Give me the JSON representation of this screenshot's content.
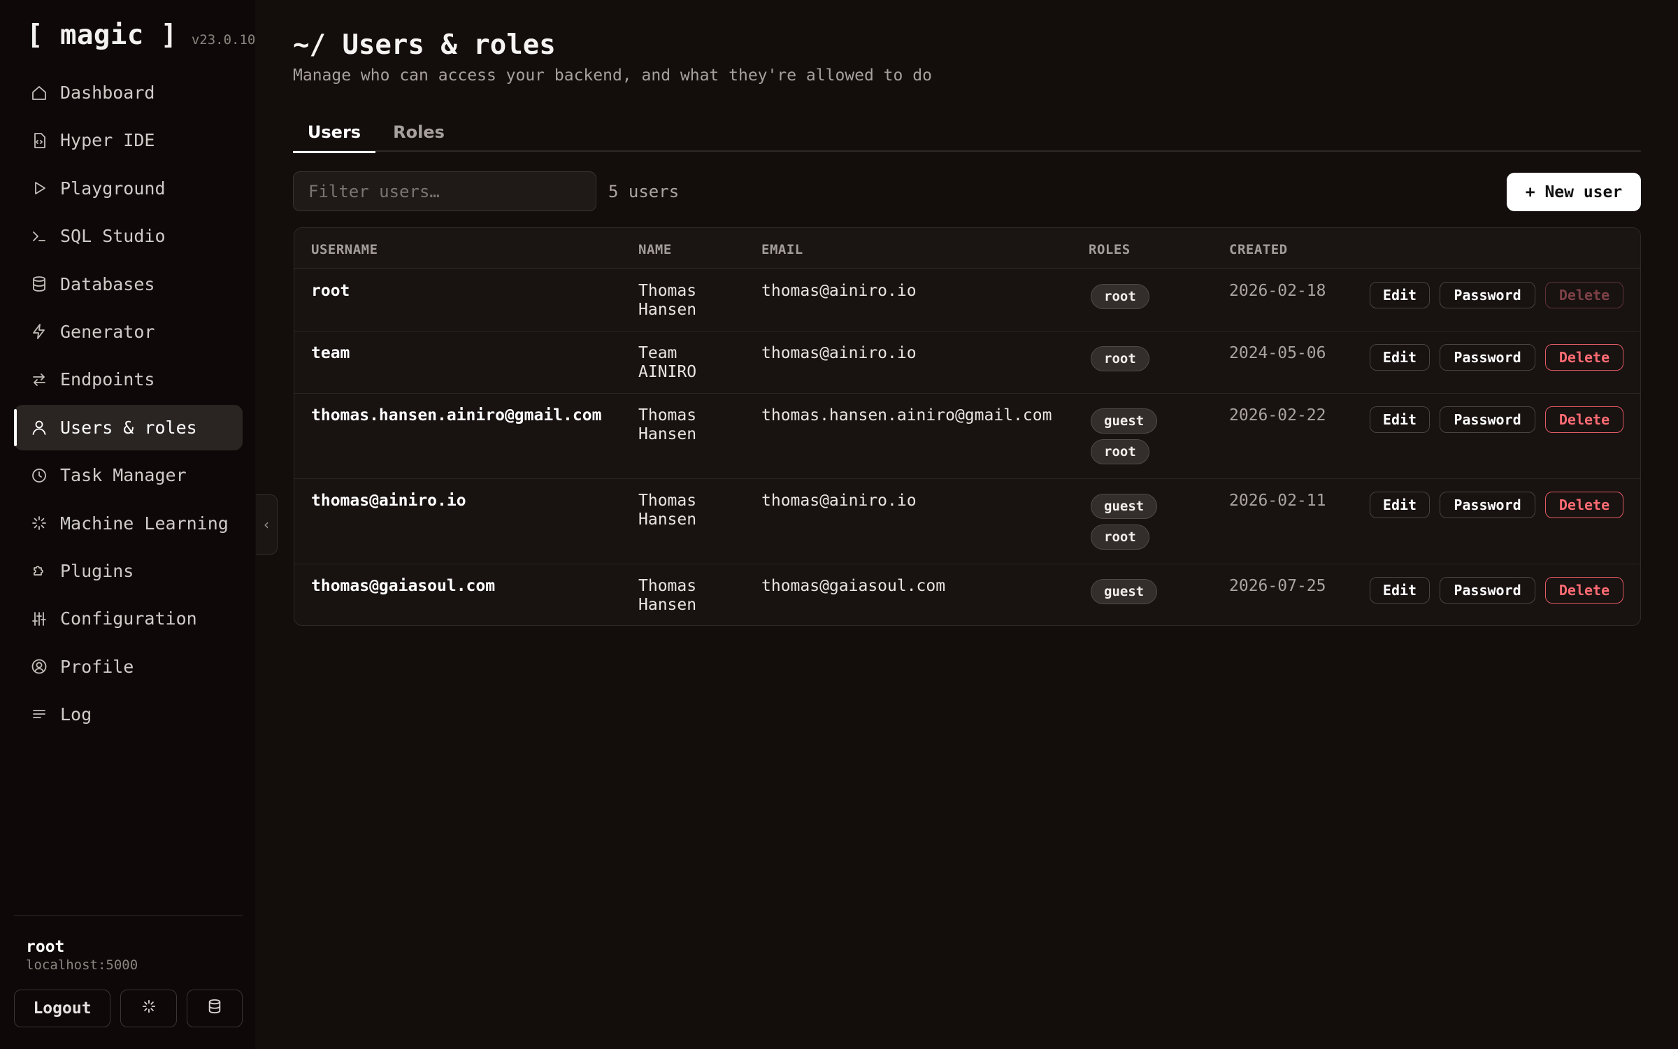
{
  "brand": {
    "name": "[ magic ]",
    "version": "v23.0.10"
  },
  "nav": [
    {
      "label": "Dashboard",
      "icon": "home-icon"
    },
    {
      "label": "Hyper IDE",
      "icon": "code-file-icon"
    },
    {
      "label": "Playground",
      "icon": "play-icon"
    },
    {
      "label": "SQL Studio",
      "icon": "terminal-icon"
    },
    {
      "label": "Databases",
      "icon": "database-icon"
    },
    {
      "label": "Generator",
      "icon": "bolt-icon"
    },
    {
      "label": "Endpoints",
      "icon": "arrows-swap-icon"
    },
    {
      "label": "Users & roles",
      "icon": "user-icon",
      "active": true
    },
    {
      "label": "Task Manager",
      "icon": "clock-icon"
    },
    {
      "label": "Machine Learning",
      "icon": "sparkle-icon"
    },
    {
      "label": "Plugins",
      "icon": "puzzle-icon"
    },
    {
      "label": "Configuration",
      "icon": "sliders-icon"
    },
    {
      "label": "Profile",
      "icon": "user-circle-icon"
    },
    {
      "label": "Log",
      "icon": "lines-icon"
    }
  ],
  "session": {
    "user": "root",
    "host": "localhost:5000",
    "logout_label": "Logout"
  },
  "page": {
    "title": "~/ Users & roles",
    "subtitle": "Manage who can access your backend, and what they're allowed to do"
  },
  "tabs": [
    {
      "label": "Users",
      "active": true
    },
    {
      "label": "Roles",
      "active": false
    }
  ],
  "toolbar": {
    "filter_placeholder": "Filter users…",
    "count_text": "5 users",
    "new_user_label": "+ New user"
  },
  "table": {
    "columns": [
      "USERNAME",
      "NAME",
      "EMAIL",
      "ROLES",
      "CREATED"
    ],
    "actions": {
      "edit": "Edit",
      "password": "Password",
      "delete": "Delete"
    },
    "rows": [
      {
        "username": "root",
        "name": "Thomas\nHansen",
        "email": "thomas@ainiro.io",
        "roles": [
          "root"
        ],
        "created": "2026-02-18",
        "delete_disabled": true
      },
      {
        "username": "team",
        "name": "Team\nAINIRO",
        "email": "thomas@ainiro.io",
        "roles": [
          "root"
        ],
        "created": "2024-05-06",
        "delete_disabled": false
      },
      {
        "username": "thomas.hansen.ainiro@gmail.com",
        "name": "Thomas\nHansen",
        "email": "thomas.hansen.ainiro@gmail.com",
        "roles": [
          "guest",
          "root"
        ],
        "created": "2026-02-22",
        "delete_disabled": false
      },
      {
        "username": "thomas@ainiro.io",
        "name": "Thomas\nHansen",
        "email": "thomas@ainiro.io",
        "roles": [
          "guest",
          "root"
        ],
        "created": "2026-02-11",
        "delete_disabled": false
      },
      {
        "username": "thomas@gaiasoul.com",
        "name": "Thomas\nHansen",
        "email": "thomas@gaiasoul.com",
        "roles": [
          "guest"
        ],
        "created": "2026-07-25",
        "delete_disabled": false
      }
    ]
  }
}
